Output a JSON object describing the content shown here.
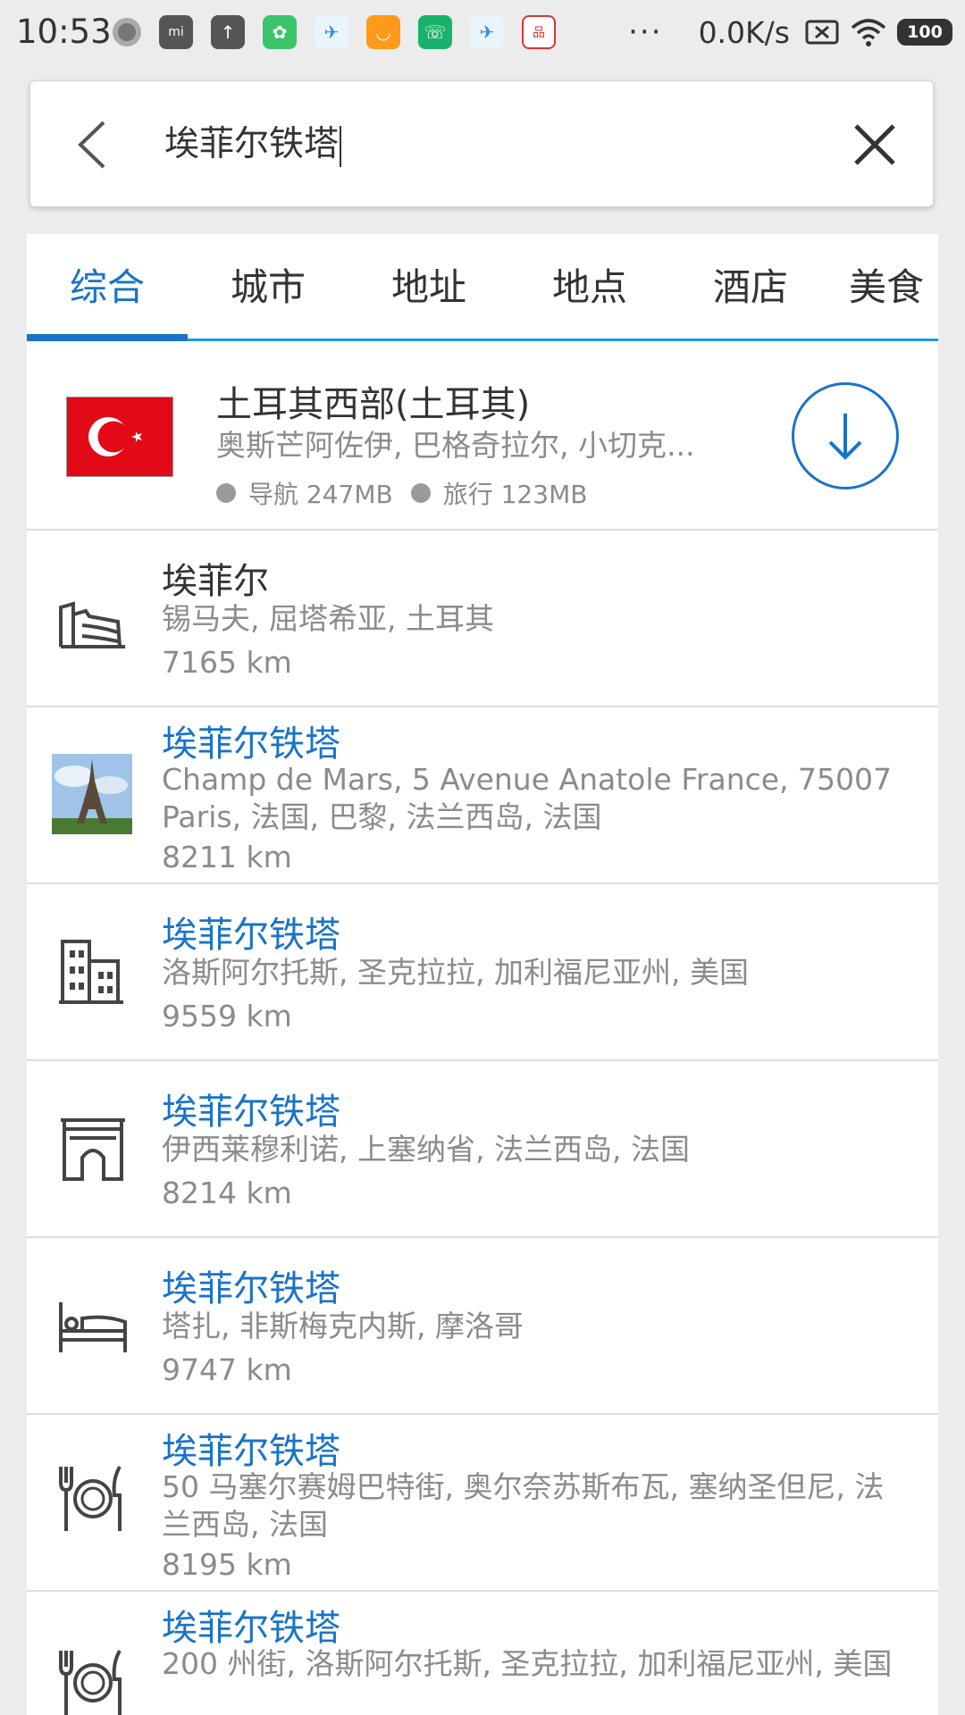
{
  "status_bar": {
    "time": "10:53",
    "net_speed": "0.0K/s",
    "battery": "100",
    "more": "···"
  },
  "search": {
    "query": "埃菲尔铁塔"
  },
  "tabs": [
    {
      "label": "综合",
      "active": true
    },
    {
      "label": "城市",
      "active": false
    },
    {
      "label": "地址",
      "active": false
    },
    {
      "label": "地点",
      "active": false
    },
    {
      "label": "酒店",
      "active": false
    },
    {
      "label": "美食",
      "active": false
    }
  ],
  "region": {
    "title": "土耳其西部(土耳其)",
    "subtitle": "奥斯芒阿佐伊, 巴格奇拉尔, 小切克...",
    "nav_size": "导航 247MB",
    "travel_size": "旅行 123MB"
  },
  "results": [
    {
      "icon": "factory-icon",
      "title": "埃菲尔",
      "address": "锡马夫, 屈塔希亚, 土耳其",
      "distance": "7165 km"
    },
    {
      "icon": "eiffel-photo",
      "title": "埃菲尔铁塔",
      "address": "Champ de Mars, 5 Avenue Anatole France, 75007 Paris, 法国, 巴黎, 法兰西岛, 法国",
      "distance": "8211 km"
    },
    {
      "icon": "buildings-icon",
      "title": "埃菲尔铁塔",
      "address": "洛斯阿尔托斯, 圣克拉拉, 加利福尼亚州, 美国",
      "distance": "9559 km"
    },
    {
      "icon": "arch-icon",
      "title": "埃菲尔铁塔",
      "address": "伊西莱穆利诺, 上塞纳省, 法兰西岛, 法国",
      "distance": "8214 km"
    },
    {
      "icon": "bed-icon",
      "title": "埃菲尔铁塔",
      "address": "塔扎, 非斯梅克内斯, 摩洛哥",
      "distance": "9747 km"
    },
    {
      "icon": "restaurant-icon",
      "title": "埃菲尔铁塔",
      "address": "50 马塞尔赛姆巴特街, 奥尔奈苏斯布瓦, 塞纳圣但尼, 法兰西岛, 法国",
      "distance": "8195 km"
    },
    {
      "icon": "restaurant-icon",
      "title": "埃菲尔铁塔",
      "address": "200 州街, 洛斯阿尔托斯, 圣克拉拉, 加利福尼亚州, 美国",
      "distance": ""
    }
  ]
}
